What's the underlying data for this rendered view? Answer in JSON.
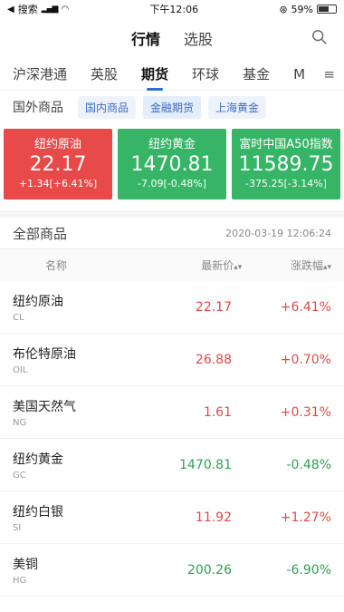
{
  "status_bar": {
    "left_label": "搜索",
    "time": "下午12:06",
    "battery_text": "59%",
    "battery_level": 0.59
  },
  "top_nav": {
    "items": [
      {
        "label": "行情",
        "active": true
      },
      {
        "label": "选股",
        "active": false
      }
    ]
  },
  "tabs": {
    "items": [
      {
        "label": "沪深港通",
        "active": false
      },
      {
        "label": "英股",
        "active": false
      },
      {
        "label": "期货",
        "active": true
      },
      {
        "label": "环球",
        "active": false
      },
      {
        "label": "基金",
        "active": false
      },
      {
        "label": "M",
        "active": false
      }
    ]
  },
  "subtabs": {
    "first": "国外商品",
    "chips": [
      {
        "label": "国内商品"
      },
      {
        "label": "金融期货"
      },
      {
        "label": "上海黄金"
      }
    ]
  },
  "cards": [
    {
      "name": "纽约原油",
      "price": "22.17",
      "change": "+1.34[+6.41%]",
      "trend": "up"
    },
    {
      "name": "纽约黄金",
      "price": "1470.81",
      "change": "-7.09[-0.48%]",
      "trend": "down"
    },
    {
      "name": "富时中国A50指数",
      "price": "11589.75",
      "change": "-375.25[-3.14%]",
      "trend": "down"
    }
  ],
  "section": {
    "title": "全部商品",
    "timestamp": "2020-03-19 12:06:24"
  },
  "table": {
    "headers": {
      "name": "名称",
      "price": "最新价",
      "change": "涨跌幅"
    },
    "rows": [
      {
        "name": "纽约原油",
        "code": "CL",
        "price": "22.17",
        "change": "+6.41%",
        "trend": "up"
      },
      {
        "name": "布伦特原油",
        "code": "OIL",
        "price": "26.88",
        "change": "+0.70%",
        "trend": "up"
      },
      {
        "name": "美国天然气",
        "code": "NG",
        "price": "1.61",
        "change": "+0.31%",
        "trend": "up"
      },
      {
        "name": "纽约黄金",
        "code": "GC",
        "price": "1470.81",
        "change": "-0.48%",
        "trend": "down"
      },
      {
        "name": "纽约白银",
        "code": "SI",
        "price": "11.92",
        "change": "+1.27%",
        "trend": "up"
      },
      {
        "name": "美铜",
        "code": "HG",
        "price": "200.26",
        "change": "-6.90%",
        "trend": "down"
      }
    ]
  },
  "colors": {
    "up": "#e84a4a",
    "down": "#35b565",
    "accent": "#2b6ed6"
  }
}
